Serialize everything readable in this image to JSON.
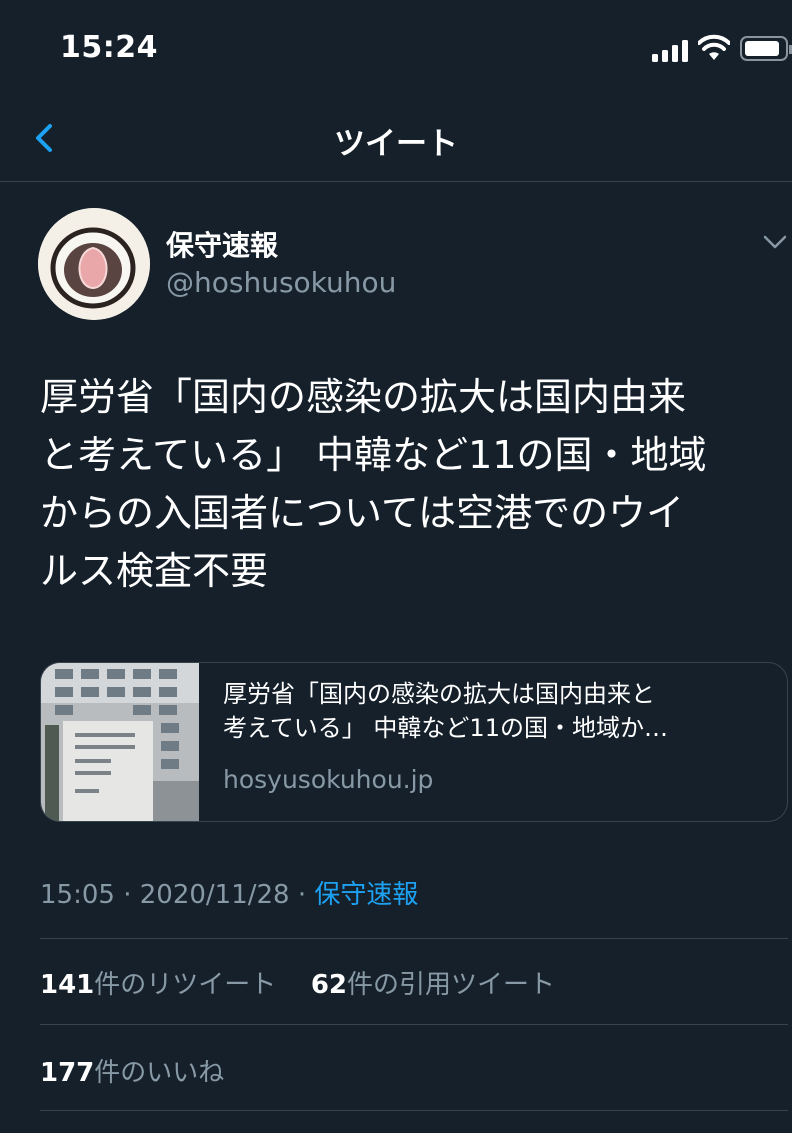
{
  "status_bar": {
    "time": "15:24"
  },
  "nav": {
    "title": "ツイート"
  },
  "author": {
    "name": "保守速報",
    "handle": "@hoshusokuhou"
  },
  "tweet": {
    "text_lines": [
      "厚労省「国内の感染の拡大は国内由来",
      "と考えている」 中韓など11の国・地域",
      "からの入国者については空港でのウイ",
      "ルス検査不要"
    ]
  },
  "link_card": {
    "title_lines": [
      "厚労省「国内の感染の拡大は国内由来と",
      "考えている」 中韓など11の国・地域か…"
    ],
    "domain": "hosyusokuhou.jp"
  },
  "meta": {
    "time": "15:05",
    "date": "2020/11/28",
    "separator": " · ",
    "source": "保守速報"
  },
  "stats": {
    "retweets_count": "141",
    "retweets_label": "件のリツイート",
    "quotes_count": "62",
    "quotes_label": "件の引用ツイート",
    "likes_count": "177",
    "likes_label": "件のいいね"
  },
  "colors": {
    "background": "#15202b",
    "accent": "#1da1f2",
    "secondary_text": "#8899a6",
    "divider": "#38444d"
  }
}
